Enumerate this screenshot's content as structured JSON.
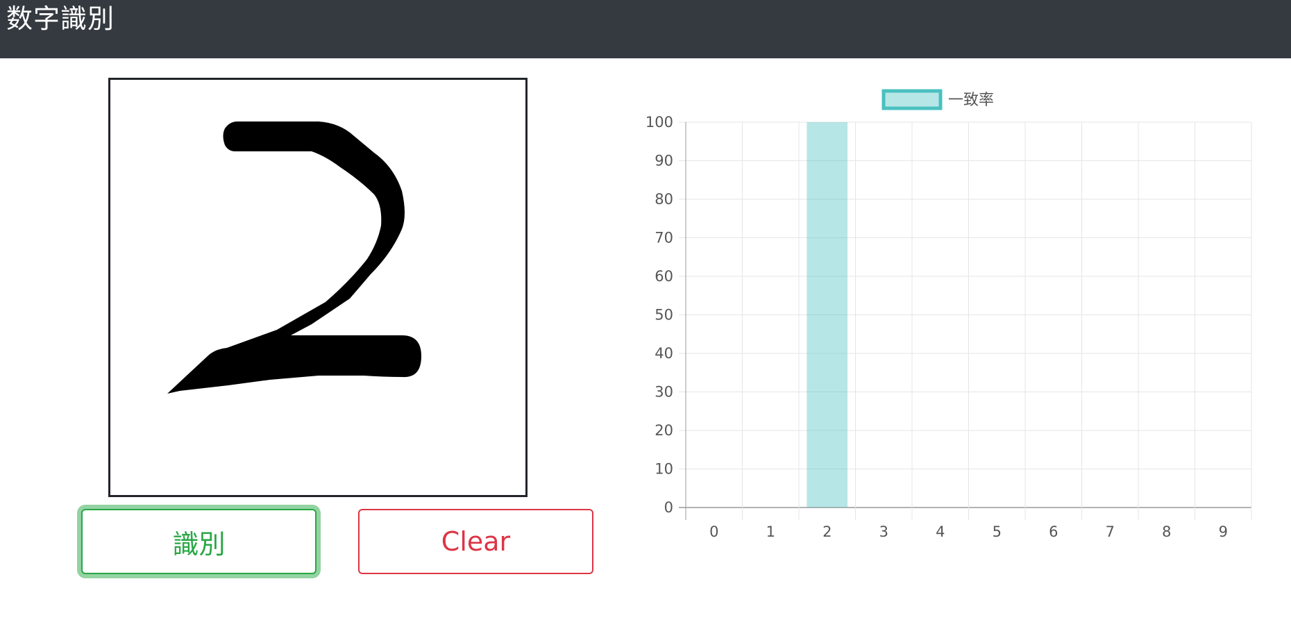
{
  "header": {
    "title": "数字識別"
  },
  "drawing_canvas": {
    "stroke_color": "#000000",
    "background": "#ffffff"
  },
  "buttons": {
    "recognize_label": "識別",
    "clear_label": "Clear"
  },
  "colors": {
    "navbar": "#343a40",
    "success": "#28a745",
    "danger": "#dc3545",
    "bar_fill": "rgba(75,192,192,0.4)",
    "bar_border": "#4bc0c0"
  },
  "chart_data": {
    "type": "bar",
    "categories": [
      "0",
      "1",
      "2",
      "3",
      "4",
      "5",
      "6",
      "7",
      "8",
      "9"
    ],
    "series": [
      {
        "name": "一致率",
        "values": [
          0,
          0,
          100,
          0,
          0,
          0,
          0,
          0,
          0,
          0
        ]
      }
    ],
    "ylim": [
      0,
      100
    ],
    "yticks": [
      0,
      10,
      20,
      30,
      40,
      50,
      60,
      70,
      80,
      90,
      100
    ],
    "grid": true,
    "legend": "top-center"
  }
}
